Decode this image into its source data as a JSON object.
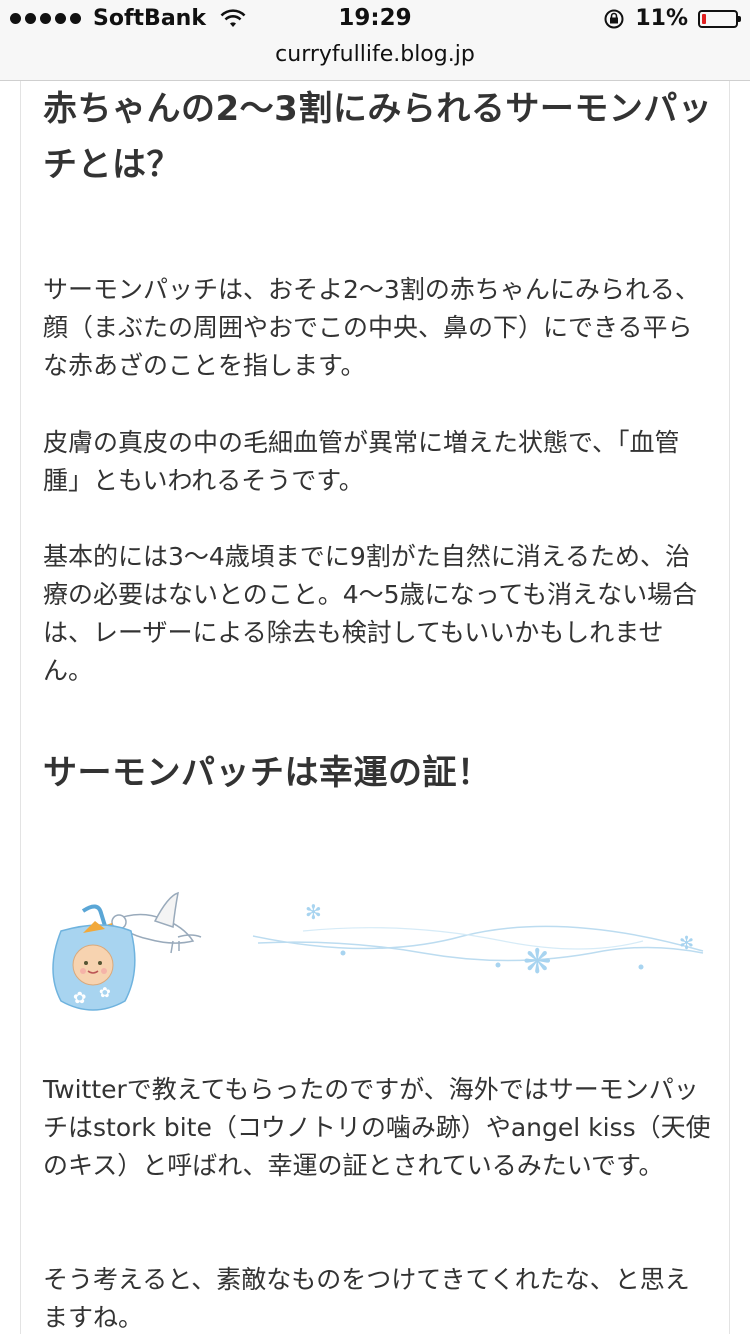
{
  "status_bar": {
    "carrier": "SoftBank",
    "time": "19:29",
    "battery_percent": "11%",
    "battery_level": 0.11,
    "icons": [
      "signal-dots",
      "wifi-icon",
      "rotation-lock-icon",
      "battery-icon"
    ]
  },
  "browser": {
    "url": "curryfullife.blog.jp"
  },
  "article": {
    "heading1": "赤ちゃんの2〜3割にみられるサーモンパッチとは？",
    "para1": "サーモンパッチは、おそよ2〜3割の赤ちゃんにみられる、顔（まぶたの周囲やおでこの中央、鼻の下）にできる平らな赤あざのことを指します。",
    "para2": "皮膚の真皮の中の毛細血管が異常に増えた状態で、「血管腫」ともいわれるそうです。",
    "para3": "基本的には3〜4歳頃までに9割がた自然に消えるため、治療の必要はないとのこと。4〜5歳になっても消えない場合は、レーザーによる除去も検討してもいいかもしれません。",
    "heading2": "サーモンパッチは幸運の証！",
    "illustration": "stork-carrying-baby-illustration",
    "para4": "Twitterで教えてもらったのですが、海外ではサーモンパッチはstork bite（コウノトリの噛み跡）やangel kiss（天使のキス）と呼ばれ、幸運の証とされているみたいです。",
    "para5": "そう考えると、素敵なものをつけてきてくれたな、と思えますね。"
  },
  "colors": {
    "battery_low": "#e02020",
    "text": "#333333",
    "illustration_blue": "#a8d4f0"
  }
}
